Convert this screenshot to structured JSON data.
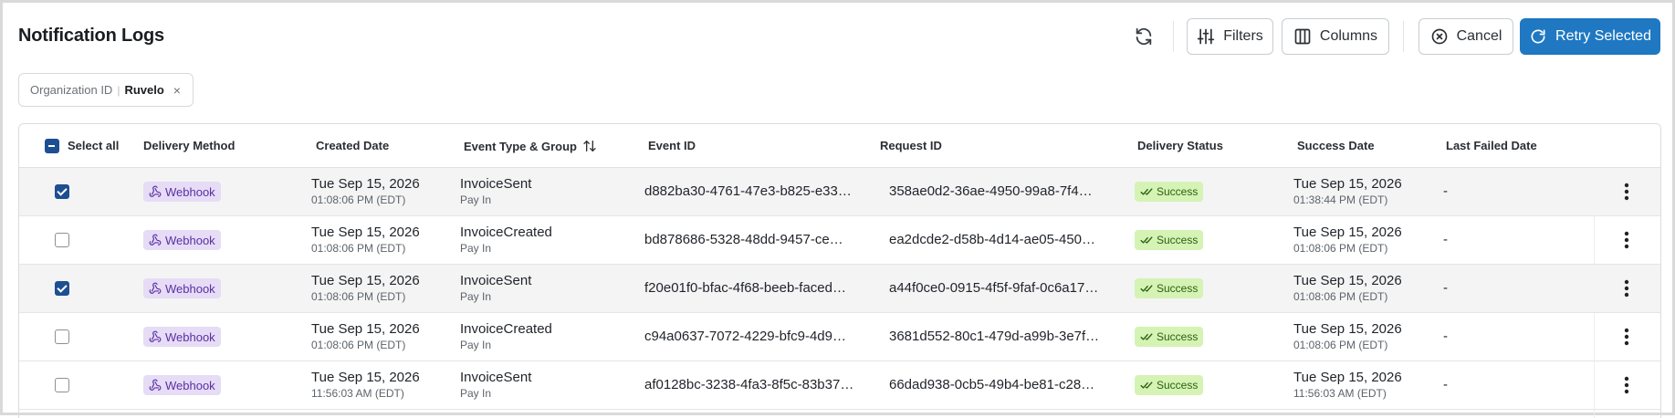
{
  "header": {
    "title": "Notification Logs",
    "filters_label": "Filters",
    "columns_label": "Columns",
    "cancel_label": "Cancel",
    "retry_label": "Retry Selected"
  },
  "filter_chip": {
    "key": "Organization ID",
    "separator": "|",
    "value": "Ruvelo",
    "remove": "×"
  },
  "table": {
    "columns": {
      "select_all": "Select all",
      "delivery_method": "Delivery Method",
      "created_date": "Created Date",
      "event_type": "Event Type & Group",
      "event_id": "Event ID",
      "request_id": "Request ID",
      "delivery_status": "Delivery Status",
      "success_date": "Success Date",
      "last_failed_date": "Last Failed Date"
    },
    "rows": [
      {
        "selected": true,
        "method": "Webhook",
        "created_date": "Tue Sep 15, 2026",
        "created_time": "01:08:06 PM (EDT)",
        "event_type": "InvoiceSent",
        "event_group": "Pay In",
        "event_id": "d882ba30-4761-47e3-b825-e33…",
        "request_id": "358ae0d2-36ae-4950-99a8-7f4…",
        "status": "Success",
        "success_date": "Tue Sep 15, 2026",
        "success_time": "01:38:44 PM (EDT)",
        "last_failed": "-"
      },
      {
        "selected": false,
        "method": "Webhook",
        "created_date": "Tue Sep 15, 2026",
        "created_time": "01:08:06 PM (EDT)",
        "event_type": "InvoiceCreated",
        "event_group": "Pay In",
        "event_id": "bd878686-5328-48dd-9457-ce…",
        "request_id": "ea2dcde2-d58b-4d14-ae05-450…",
        "status": "Success",
        "success_date": "Tue Sep 15, 2026",
        "success_time": "01:08:06 PM (EDT)",
        "last_failed": "-"
      },
      {
        "selected": true,
        "method": "Webhook",
        "created_date": "Tue Sep 15, 2026",
        "created_time": "01:08:06 PM (EDT)",
        "event_type": "InvoiceSent",
        "event_group": "Pay In",
        "event_id": "f20e01f0-bfac-4f68-beeb-faced…",
        "request_id": "a44f0ce0-0915-4f5f-9faf-0c6a17…",
        "status": "Success",
        "success_date": "Tue Sep 15, 2026",
        "success_time": "01:08:06 PM (EDT)",
        "last_failed": "-"
      },
      {
        "selected": false,
        "method": "Webhook",
        "created_date": "Tue Sep 15, 2026",
        "created_time": "01:08:06 PM (EDT)",
        "event_type": "InvoiceCreated",
        "event_group": "Pay In",
        "event_id": "c94a0637-7072-4229-bfc9-4d9…",
        "request_id": "3681d552-80c1-479d-a99b-3e7f…",
        "status": "Success",
        "success_date": "Tue Sep 15, 2026",
        "success_time": "01:08:06 PM (EDT)",
        "last_failed": "-"
      },
      {
        "selected": false,
        "method": "Webhook",
        "created_date": "Tue Sep 15, 2026",
        "created_time": "11:56:03 AM (EDT)",
        "event_type": "InvoiceSent",
        "event_group": "Pay In",
        "event_id": "af0128bc-3238-4fa3-8f5c-83b37…",
        "request_id": "66dad938-0cb5-49b4-be81-c28…",
        "status": "Success",
        "success_date": "Tue Sep 15, 2026",
        "success_time": "11:56:03 AM (EDT)",
        "last_failed": "-"
      }
    ]
  },
  "colors": {
    "primary": "#1f78c1",
    "checkbox": "#1d4f91",
    "method_badge_bg": "#e6dcf6",
    "method_badge_fg": "#5b2fa3",
    "status_badge_bg": "#d5f3b4",
    "status_badge_fg": "#2b6112"
  },
  "icons": {
    "refresh": "refresh-icon",
    "filters": "sliders-icon",
    "columns": "columns-icon",
    "cancel": "circle-x-icon",
    "retry": "retry-icon",
    "sort": "sort-arrows-icon",
    "method": "webhook-icon",
    "status": "double-check-icon",
    "row_menu": "kebab-menu-icon"
  }
}
